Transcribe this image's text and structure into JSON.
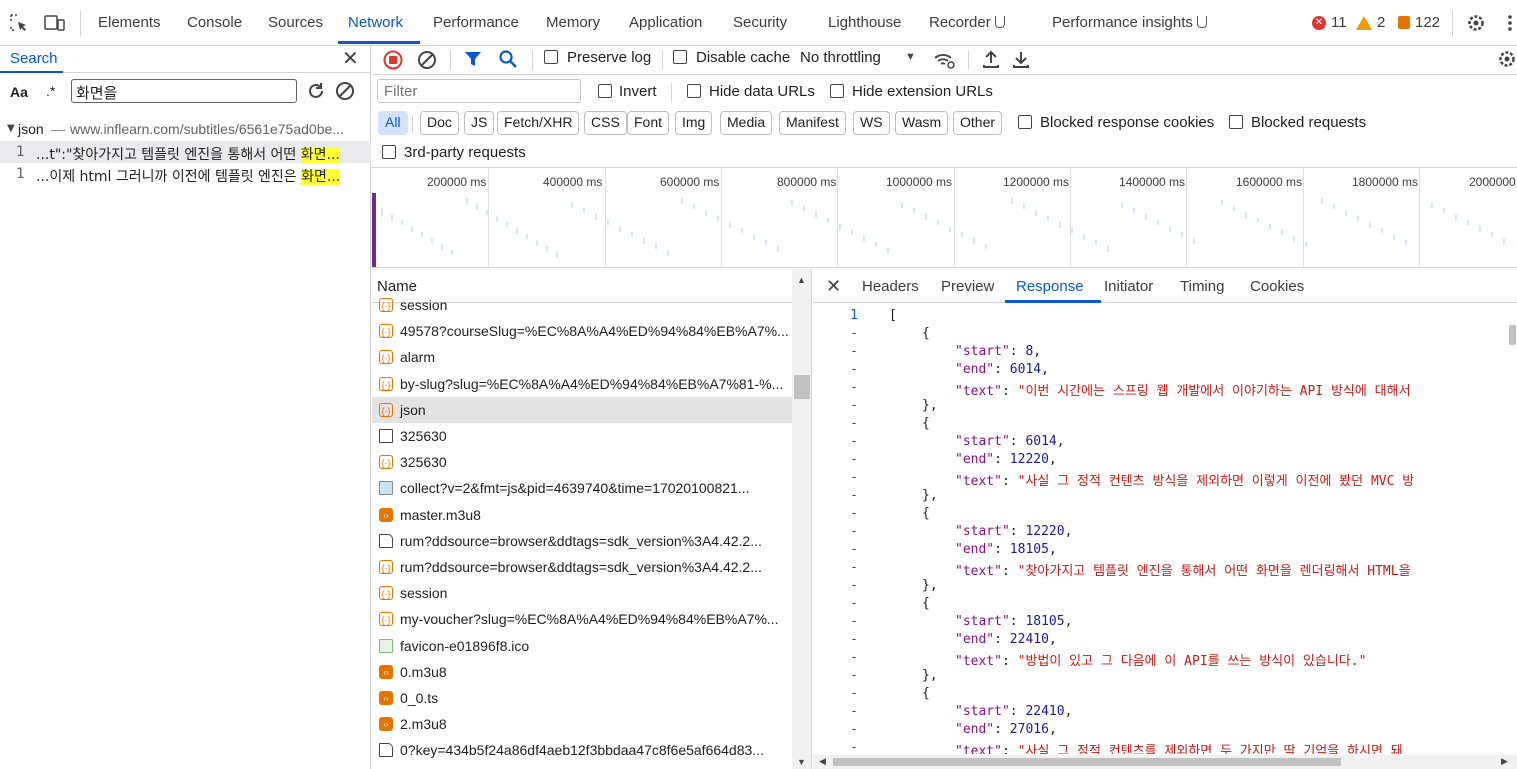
{
  "devtools_tabs": [
    "Elements",
    "Console",
    "Sources",
    "Network",
    "Performance",
    "Memory",
    "Application",
    "Security",
    "Lighthouse",
    "Recorder",
    "Performance insights"
  ],
  "active_tab": "Network",
  "status": {
    "errors": "11",
    "warnings": "2",
    "issues": "122"
  },
  "search_panel": {
    "title": "Search",
    "case_label": "Aa",
    "regex_label": ".*",
    "query": "화면을",
    "result_file_name": "json",
    "result_file_url": "www.inflearn.com/subtitles/6561e75ad0be...",
    "results": [
      {
        "line": "1",
        "prefix": "...t\":\"찾아가지고 템플릿 엔진을 통해서 어떤 ",
        "match": "화면..."
      },
      {
        "line": "1",
        "prefix": "...이제 html 그러니까 이전에 템플릿 엔진은 ",
        "match": "화면..."
      }
    ]
  },
  "network_toolbar": {
    "preserve_log": "Preserve log",
    "disable_cache": "Disable cache",
    "throttling": "No throttling"
  },
  "filter_bar": {
    "placeholder": "Filter",
    "invert": "Invert",
    "hide_data_urls": "Hide data URLs",
    "hide_extension_urls": "Hide extension URLs",
    "types": [
      "All",
      "Doc",
      "JS",
      "Fetch/XHR",
      "CSS",
      "Font",
      "Img",
      "Media",
      "Manifest",
      "WS",
      "Wasm",
      "Other"
    ],
    "active_type": "All",
    "blocked_response_cookies": "Blocked response cookies",
    "blocked_requests": "Blocked requests",
    "third_party": "3rd-party requests"
  },
  "overview_ticks": [
    "200000 ms",
    "400000 ms",
    "600000 ms",
    "800000 ms",
    "1000000 ms",
    "1200000 ms",
    "1400000 ms",
    "1600000 ms",
    "1800000 ms",
    "2000000"
  ],
  "requests_header": "Name",
  "requests": [
    {
      "name": "session",
      "icon": "json"
    },
    {
      "name": "49578?courseSlug=%EC%8A%A4%ED%94%84%EB%A7%...",
      "icon": "json"
    },
    {
      "name": "alarm",
      "icon": "json"
    },
    {
      "name": "by-slug?slug=%EC%8A%A4%ED%94%84%EB%A7%81-%...",
      "icon": "json"
    },
    {
      "name": "json",
      "icon": "json",
      "selected": true
    },
    {
      "name": "325630",
      "icon": "doc"
    },
    {
      "name": "325630",
      "icon": "json"
    },
    {
      "name": "collect?v=2&fmt=js&pid=4639740&time=17020100821...",
      "icon": "img"
    },
    {
      "name": "master.m3u8",
      "icon": "media"
    },
    {
      "name": "rum?ddsource=browser&ddtags=sdk_version%3A4.42.2...",
      "icon": "page"
    },
    {
      "name": "rum?ddsource=browser&ddtags=sdk_version%3A4.42.2...",
      "icon": "json"
    },
    {
      "name": "session",
      "icon": "json"
    },
    {
      "name": "my-voucher?slug=%EC%8A%A4%ED%94%84%EB%A7%...",
      "icon": "json"
    },
    {
      "name": "favicon-e01896f8.ico",
      "icon": "fav"
    },
    {
      "name": "0.m3u8",
      "icon": "media"
    },
    {
      "name": "0_0.ts",
      "icon": "media"
    },
    {
      "name": "2.m3u8",
      "icon": "media"
    },
    {
      "name": "0?key=434b5f24a86df4aeb12f3bbdaa47c8f6e5af664d83...",
      "icon": "page"
    }
  ],
  "detail_tabs": [
    "Headers",
    "Preview",
    "Response",
    "Initiator",
    "Timing",
    "Cookies"
  ],
  "active_detail_tab": "Response",
  "response_lines": [
    {
      "ln": "1",
      "indent": 0,
      "text": "["
    },
    {
      "ln": "-",
      "indent": 1,
      "text": "{"
    },
    {
      "ln": "-",
      "indent": 2,
      "key": "\"start\"",
      "num": "8",
      "tail": ","
    },
    {
      "ln": "-",
      "indent": 2,
      "key": "\"end\"",
      "num": "6014",
      "tail": ","
    },
    {
      "ln": "-",
      "indent": 2,
      "key": "\"text\"",
      "str": "\"이번 시간에는 스프링 웹 개발에서 이야기하는 API 방식에 대해서"
    },
    {
      "ln": "-",
      "indent": 1,
      "text": "},"
    },
    {
      "ln": "-",
      "indent": 1,
      "text": "{"
    },
    {
      "ln": "-",
      "indent": 2,
      "key": "\"start\"",
      "num": "6014",
      "tail": ","
    },
    {
      "ln": "-",
      "indent": 2,
      "key": "\"end\"",
      "num": "12220",
      "tail": ","
    },
    {
      "ln": "-",
      "indent": 2,
      "key": "\"text\"",
      "str": "\"사실 그 정적 컨텐츠 방식을 제외하면 이렇게 이전에 봤던 MVC 방"
    },
    {
      "ln": "-",
      "indent": 1,
      "text": "},"
    },
    {
      "ln": "-",
      "indent": 1,
      "text": "{"
    },
    {
      "ln": "-",
      "indent": 2,
      "key": "\"start\"",
      "num": "12220",
      "tail": ","
    },
    {
      "ln": "-",
      "indent": 2,
      "key": "\"end\"",
      "num": "18105",
      "tail": ","
    },
    {
      "ln": "-",
      "indent": 2,
      "key": "\"text\"",
      "str": "\"찾아가지고 템플릿 엔진을 통해서 어떤 화면을 렌더링해서 HTML을"
    },
    {
      "ln": "-",
      "indent": 1,
      "text": "},"
    },
    {
      "ln": "-",
      "indent": 1,
      "text": "{"
    },
    {
      "ln": "-",
      "indent": 2,
      "key": "\"start\"",
      "num": "18105",
      "tail": ","
    },
    {
      "ln": "-",
      "indent": 2,
      "key": "\"end\"",
      "num": "22410",
      "tail": ","
    },
    {
      "ln": "-",
      "indent": 2,
      "key": "\"text\"",
      "str": "\"방법이 있고 그 다음에 이 API를 쓰는 방식이 있습니다.\""
    },
    {
      "ln": "-",
      "indent": 1,
      "text": "},"
    },
    {
      "ln": "-",
      "indent": 1,
      "text": "{"
    },
    {
      "ln": "-",
      "indent": 2,
      "key": "\"start\"",
      "num": "22410",
      "tail": ","
    },
    {
      "ln": "-",
      "indent": 2,
      "key": "\"end\"",
      "num": "27016",
      "tail": ","
    },
    {
      "ln": "-",
      "indent": 2,
      "key": "\"text\"",
      "str": "\"사실 그 정적 컨텐츠를 제외하면 두 가지만 딱 기억을 하시면 돼"
    }
  ],
  "colors": {
    "accent": "#0b57d0",
    "highlight": "#ffff33",
    "error": "#dc362e",
    "warning": "#f29900"
  }
}
